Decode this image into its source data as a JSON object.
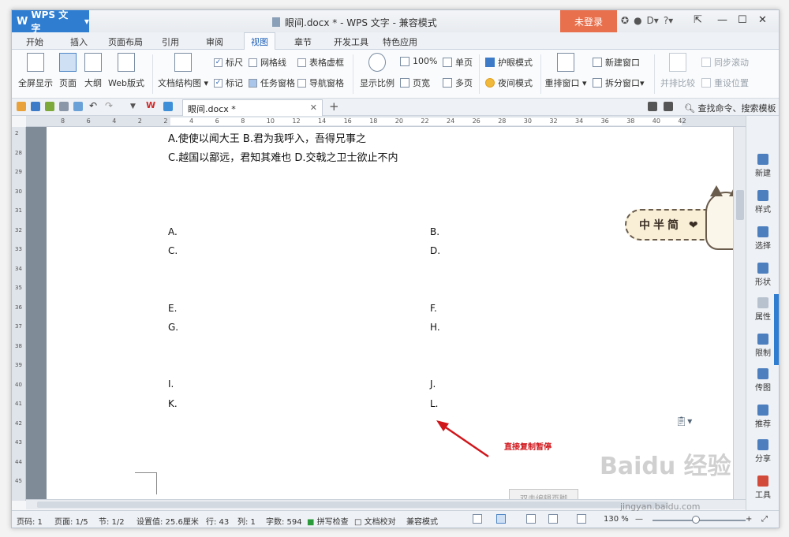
{
  "app": {
    "button_label": "WPS 文字",
    "window_title": "眼间.docx * - WPS 文字 - 兼容模式",
    "login_label": "未登录"
  },
  "menu_tabs": [
    "开始",
    "插入",
    "页面布局",
    "引用",
    "审阅",
    "视图",
    "章节",
    "开发工具",
    "特色应用"
  ],
  "ribbon": {
    "fullscreen": "全屏显示",
    "page": "页面",
    "outline": "大纲",
    "web": "Web版式",
    "doc_structure": "文档结构图",
    "ruler": "标尺",
    "gridlines": "网格线",
    "table_dashed": "表格虚框",
    "marks": "标记",
    "task_pane": "任务窗格",
    "nav_pane": "导航窗格",
    "zoom_ratio": "显示比例",
    "zoom_100": "100%",
    "page_width": "页宽",
    "single_page": "单页",
    "multi_page": "多页",
    "eye_mode": "护眼模式",
    "night_mode": "夜间模式",
    "rearrange": "重排窗口",
    "new_window": "新建窗口",
    "split_window": "拆分窗口",
    "side_compare": "并排比较",
    "sync_scroll": "同步滚动",
    "reset_pos": "重设位置"
  },
  "quickbar": {
    "doc_tab": "眼间.docx *",
    "search": "查找命令、搜索模板"
  },
  "hruler_labels": [
    "8",
    "6",
    "4",
    "2",
    "2",
    "4",
    "6",
    "8",
    "10",
    "12",
    "14",
    "16",
    "18",
    "20",
    "22",
    "24",
    "26",
    "28",
    "30",
    "32",
    "34",
    "36",
    "38",
    "40",
    "42"
  ],
  "vruler_labels": [
    "2",
    "28",
    "29",
    "30",
    "31",
    "32",
    "33",
    "34",
    "35",
    "36",
    "37",
    "38",
    "39",
    "40",
    "41",
    "42",
    "43",
    "44",
    "45"
  ],
  "document": {
    "line1": "A.使使以闻大王 B.君为我呼入，吾得兄事之",
    "line2": "C.越国以鄙远，君知其难也 D.交戟之卫士欲止不内",
    "options_left": [
      "A.",
      "C.",
      "E.",
      "G.",
      "I.",
      "K."
    ],
    "options_right": [
      "B.",
      "D.",
      "F.",
      "H.",
      "J.",
      "L."
    ],
    "annotation": "直接复制暂停",
    "footer_button": "双击编辑页脚",
    "sticker": "中半简 ❤"
  },
  "sidepanel": [
    "新建",
    "样式",
    "选择",
    "形状",
    "属性",
    "限制",
    "传图",
    "推荐",
    "分享",
    "工具"
  ],
  "status": {
    "page_num": "页码: 1",
    "pages": "页面: 1/5",
    "section": "节: 1/2",
    "setting": "设置值: 25.6厘米",
    "row": "行: 43",
    "col": "列: 1",
    "words": "字数: 594",
    "spell": "拼写检查",
    "proof": "文档校对",
    "compat": "兼容模式",
    "zoom": "130 %"
  },
  "watermark": {
    "logo": "Baidu 经验",
    "url": "jingyan.baidu.com"
  }
}
